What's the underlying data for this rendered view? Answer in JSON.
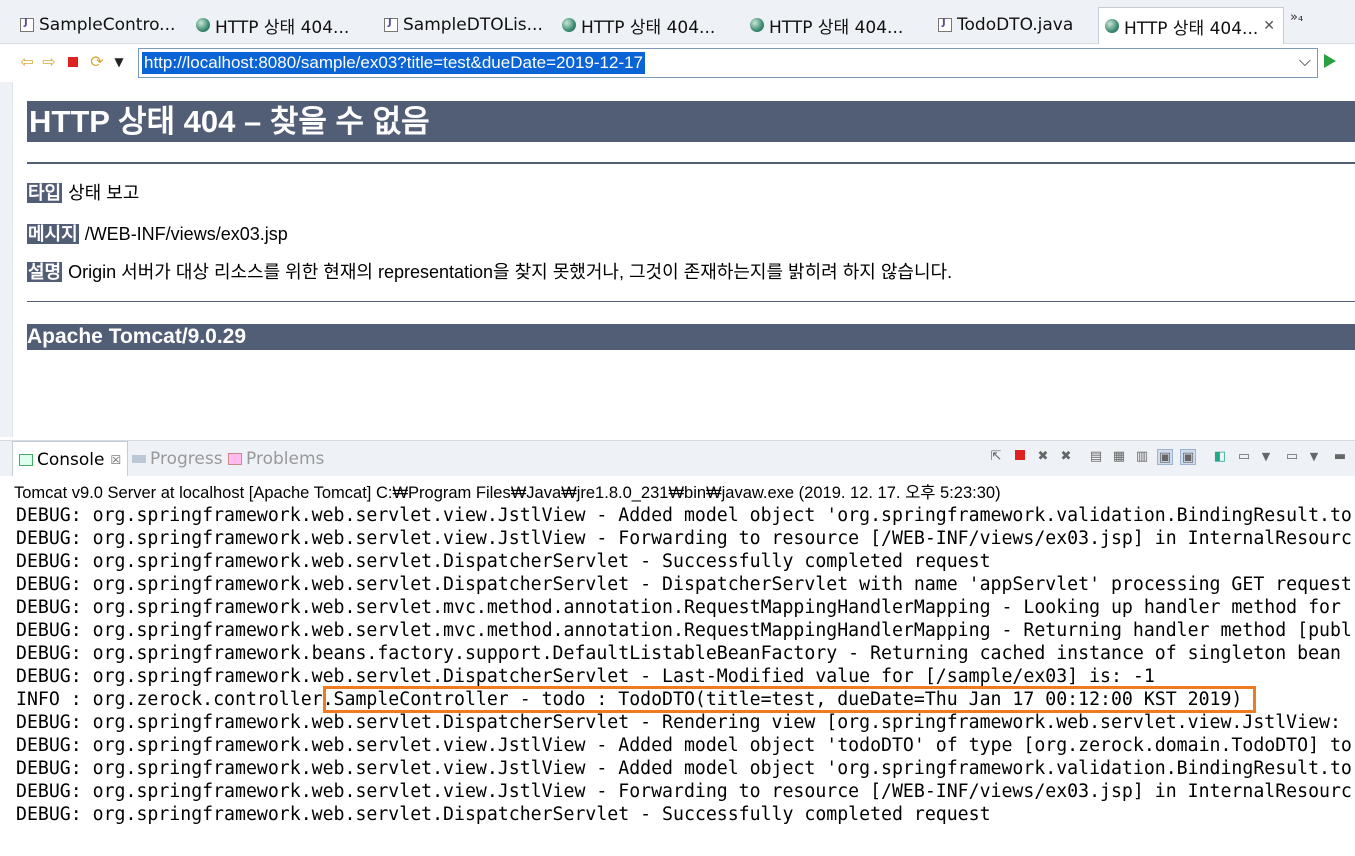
{
  "editor_tabs": [
    {
      "label": "SampleContro...",
      "icon": "java-file-icon",
      "active": false
    },
    {
      "label": "HTTP 상태 404...",
      "icon": "globe-icon",
      "active": false
    },
    {
      "label": "SampleDTOLis...",
      "icon": "java-file-icon",
      "active": false
    },
    {
      "label": "HTTP 상태 404...",
      "icon": "globe-icon",
      "active": false
    },
    {
      "label": "HTTP 상태 404...",
      "icon": "globe-icon",
      "active": false
    },
    {
      "label": "TodoDTO.java",
      "icon": "java-file-icon",
      "active": false
    },
    {
      "label": "HTTP 상태 404...",
      "icon": "globe-icon",
      "active": true
    }
  ],
  "overflow_tabs": "»₄",
  "browser": {
    "url": "http://localhost:8080/sample/ex03?title=test&dueDate=2019-12-17"
  },
  "error_page": {
    "heading": "HTTP 상태 404 – 찾을 수 없음",
    "type_label": "타입",
    "type_value": "상태 보고",
    "message_label": "메시지",
    "message_value": "/WEB-INF/views/ex03.jsp",
    "description_label": "설명",
    "description_value": "Origin 서버가 대상 리소스를 위한 현재의 representation을 찾지 못했거나, 그것이 존재하는지를 밝히려 하지 않습니다.",
    "footer": "Apache Tomcat/9.0.29"
  },
  "console_tabs": [
    {
      "label": "Console",
      "icon": "console-icon",
      "active": true
    },
    {
      "label": "Progress",
      "icon": "progress-icon",
      "active": false
    },
    {
      "label": "Problems",
      "icon": "problems-icon",
      "active": false
    }
  ],
  "console": {
    "title": "Tomcat v9.0 Server at localhost [Apache Tomcat] C:₩Program Files₩Java₩jre1.8.0_231₩bin₩javaw.exe (2019. 12. 17. 오후 5:23:30)",
    "lines": [
      "DEBUG: org.springframework.web.servlet.view.JstlView - Added model object 'org.springframework.validation.BindingResult.to",
      "DEBUG: org.springframework.web.servlet.view.JstlView - Forwarding to resource [/WEB-INF/views/ex03.jsp] in InternalResourc",
      "DEBUG: org.springframework.web.servlet.DispatcherServlet - Successfully completed request",
      "DEBUG: org.springframework.web.servlet.DispatcherServlet - DispatcherServlet with name 'appServlet' processing GET request",
      "DEBUG: org.springframework.web.servlet.mvc.method.annotation.RequestMappingHandlerMapping - Looking up handler method for",
      "DEBUG: org.springframework.web.servlet.mvc.method.annotation.RequestMappingHandlerMapping - Returning handler method [publ",
      "DEBUG: org.springframework.beans.factory.support.DefaultListableBeanFactory - Returning cached instance of singleton bean",
      "DEBUG: org.springframework.web.servlet.DispatcherServlet - Last-Modified value for [/sample/ex03] is: -1",
      "INFO : org.zerock.controller.SampleController - todo : TodoDTO(title=test, dueDate=Thu Jan 17 00:12:00 KST 2019)",
      "DEBUG: org.springframework.web.servlet.DispatcherServlet - Rendering view [org.springframework.web.servlet.view.JstlView:",
      "DEBUG: org.springframework.web.servlet.view.JstlView - Added model object 'todoDTO' of type [org.zerock.domain.TodoDTO] to",
      "DEBUG: org.springframework.web.servlet.view.JstlView - Added model object 'org.springframework.validation.BindingResult.to",
      "DEBUG: org.springframework.web.servlet.view.JstlView - Forwarding to resource [/WEB-INF/views/ex03.jsp] in InternalResourc",
      "DEBUG: org.springframework.web.servlet.DispatcherServlet - Successfully completed request"
    ],
    "highlight_color": "#f07a20"
  },
  "colors": {
    "tomcat_banner": "#525d76",
    "url_selection": "#0a64d6"
  }
}
